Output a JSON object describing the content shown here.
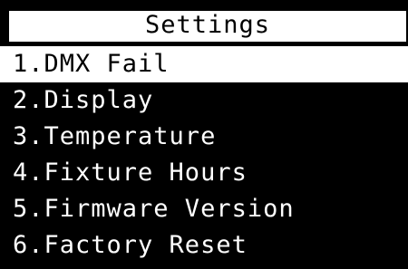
{
  "title": "Settings",
  "menu": {
    "selected_index": 0,
    "items": [
      {
        "label": "1.DMX Fail"
      },
      {
        "label": "2.Display"
      },
      {
        "label": "3.Temperature"
      },
      {
        "label": "4.Fixture Hours"
      },
      {
        "label": "5.Firmware Version"
      },
      {
        "label": "6.Factory Reset"
      }
    ]
  },
  "colors": {
    "background": "#000000",
    "foreground": "#ffffff",
    "highlight_bg": "#ffffff",
    "highlight_fg": "#000000"
  }
}
